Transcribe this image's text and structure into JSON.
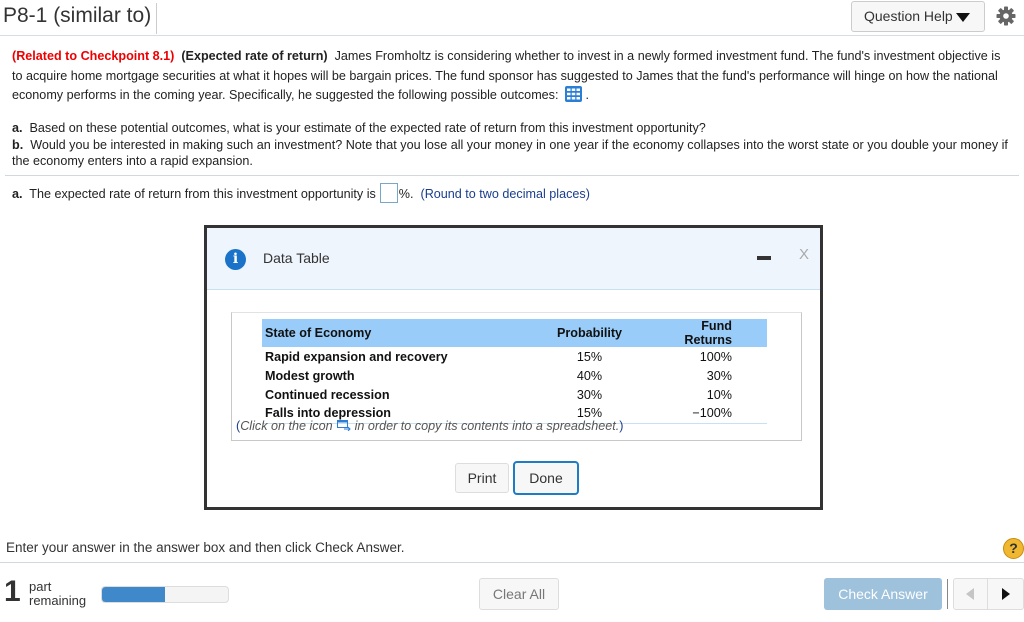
{
  "header": {
    "title": "P8-1 (similar to)",
    "question_help_label": "Question Help",
    "icons": {
      "question_help_dropdown": "caret-down-icon",
      "settings": "gear-icon"
    }
  },
  "question": {
    "related": "(Related to Checkpoint 8.1)",
    "topic": "(Expected rate of return)",
    "body": "James Fromholtz is considering whether to invest in a newly formed investment fund.  The fund's investment objective is to acquire home mortgage securities at what it hopes will be bargain prices.  The fund sponsor has suggested to James that the fund's performance will hinge on how the national economy performs in the coming year.  Specifically, he suggested the following possible outcomes:",
    "after_icon": ".",
    "table_icon": "data-table-icon",
    "part_a_label": "a.",
    "part_a": "Based on these potential outcomes, what is your estimate of the expected rate of return from this investment opportunity?",
    "part_b_label": "b.",
    "part_b": "Would you be interested in making such an investment?  Note that you lose all your money in one year if the economy collapses into the worst state or you double your money if the economy enters into a rapid expansion."
  },
  "answer": {
    "label": "a.",
    "prefix": "The expected rate of return from this investment opportunity is",
    "value": "",
    "suffix": "%.",
    "hint": "(Round to two decimal places)"
  },
  "dialog": {
    "title": "Data Table",
    "icons": {
      "info": "info-icon",
      "minimize": "minimize-icon",
      "close": "close-icon"
    },
    "close_label": "X",
    "columns": [
      "State of Economy",
      "Probability",
      "Fund Returns"
    ],
    "rows": [
      [
        "Rapid expansion and recovery",
        "15%",
        "100%"
      ],
      [
        "Modest growth",
        "40%",
        "30%"
      ],
      [
        "Continued recession",
        "30%",
        "10%"
      ],
      [
        "Falls into depression",
        "15%",
        "−100%"
      ]
    ],
    "copy_note_open": "(",
    "copy_note_pre": "Click on the icon",
    "copy_note_post": "in order to copy its contents into a spreadsheet.",
    "copy_note_close": ")",
    "print_label": "Print",
    "done_label": "Done"
  },
  "footer": {
    "instruction": "Enter your answer in the answer box and then click Check Answer.",
    "help_label": "?",
    "parts_count": "1",
    "parts_label_1": "part",
    "parts_label_2": "remaining",
    "progress_fraction": 0.5,
    "clear_all_label": "Clear All",
    "check_answer_label": "Check Answer",
    "icons": {
      "prev": "triangle-left-icon",
      "next": "triangle-right-icon"
    }
  }
}
